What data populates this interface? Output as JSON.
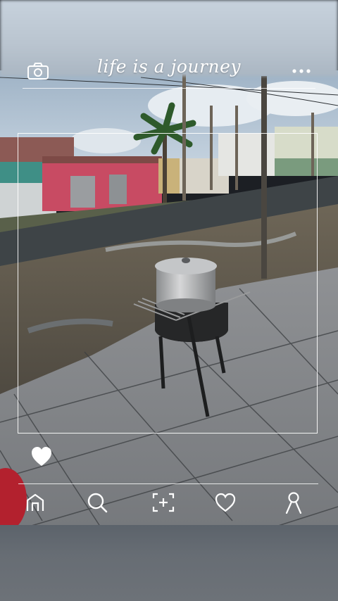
{
  "header": {
    "title": "life is a journey",
    "camera_icon": "camera-icon",
    "more_icon": "more-dots-icon"
  },
  "photo": {
    "description_icon": "photo"
  },
  "actions": {
    "like_icon": "heart-filled-icon"
  },
  "bottom_nav": {
    "items": [
      {
        "icon": "home-icon"
      },
      {
        "icon": "search-icon"
      },
      {
        "icon": "add-post-icon"
      },
      {
        "icon": "heart-outline-icon"
      },
      {
        "icon": "profile-icon"
      }
    ]
  },
  "colors": {
    "frame_lines": "#ffffff",
    "accent": "#ffffff"
  }
}
